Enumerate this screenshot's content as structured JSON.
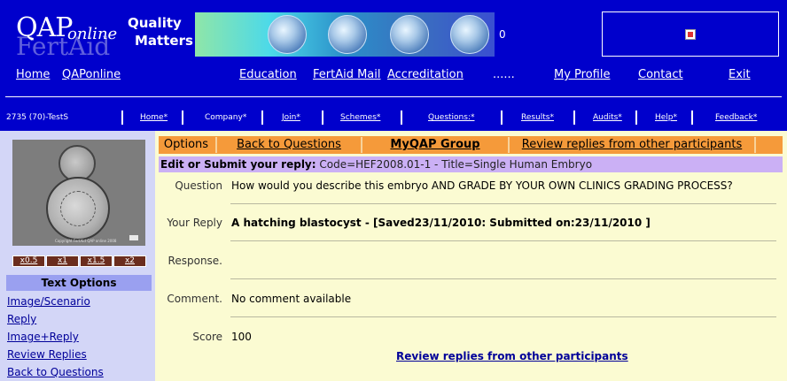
{
  "brand": {
    "logo_main": "QAP",
    "logo_sub": "online",
    "logo_fert": "FertAid",
    "tagline_line1": "Quality",
    "tagline_line2": "Matters",
    "strip_counter": "0"
  },
  "nav": {
    "home": "Home",
    "qaponline": "QAPonline",
    "education": "Education",
    "fertaid_mail": "FertAid Mail",
    "accreditation": "Accreditation",
    "dots": "......",
    "my_profile": "My Profile",
    "contact": "Contact",
    "exit": "Exit"
  },
  "subnav": {
    "user_code": "2735 (70)-TestS",
    "items": [
      "Home*",
      "Company*",
      "Join*",
      "Schemes*",
      "Questions:*",
      "Results*",
      "Audits*",
      "Help*",
      "Feedback*"
    ]
  },
  "sidebar": {
    "zoom": [
      "x0.5",
      "x1",
      "x1.5",
      "x2"
    ],
    "text_options_title": "Text Options",
    "links": [
      "Image/Scenario",
      "Reply",
      "Image+Reply",
      "Review Replies",
      "Back to Questions"
    ],
    "photo_caption": "Copyright FertAid QAP online 2008"
  },
  "main": {
    "tabs": [
      "Options",
      "Back to Questions",
      "MyQAP Group",
      "Review replies from other participants"
    ],
    "edit_label": "Edit or Submit your reply:",
    "edit_code": "Code=HEF2008.01-1 - Title=Single Human Embryo",
    "rows": [
      {
        "label": "Question",
        "value": "How would you describe this embryo AND GRADE BY YOUR OWN CLINICS GRADING PROCESS?"
      },
      {
        "label": "Your Reply",
        "value": "A hatching blastocyst - [Saved23/11/2010: Submitted on:23/11/2010 ]"
      },
      {
        "label": "Response.",
        "value": ""
      },
      {
        "label": "Comment.",
        "value": "No comment available"
      },
      {
        "label": "Score",
        "value": "100"
      }
    ],
    "review_link": "Review replies from other participants"
  },
  "colors": {
    "header_bg": "#0000cc",
    "sidebar_bg": "#d3d6f7",
    "main_bg": "#fbfbd2",
    "tab_bg": "#f59a3a",
    "edit_bar_bg": "#cbb0f5",
    "zoom_btn_bg": "#6b2d1e",
    "link_color": "#000099"
  }
}
